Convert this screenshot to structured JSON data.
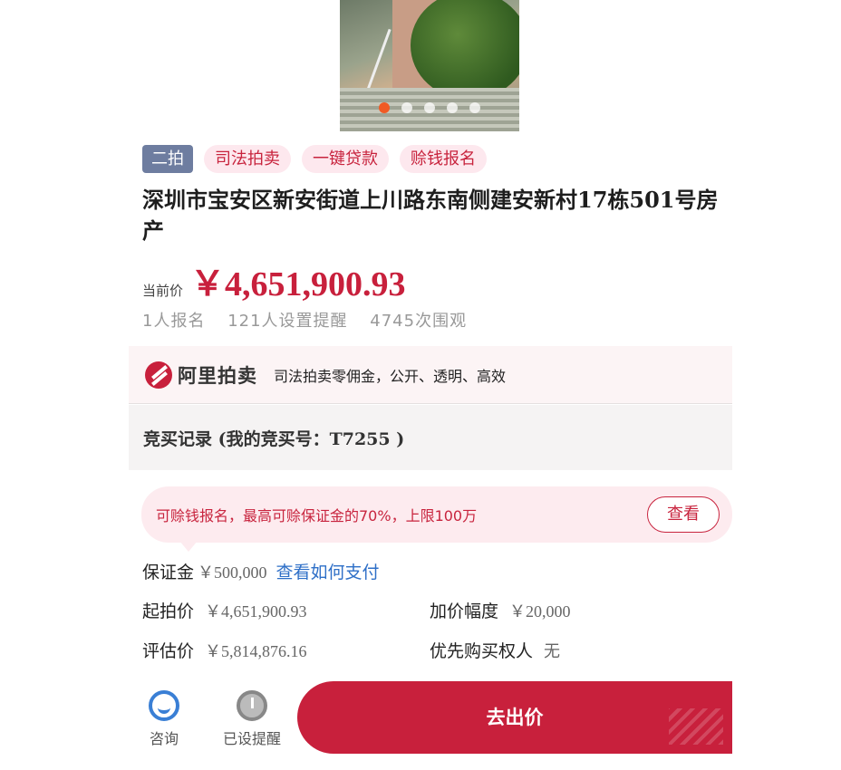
{
  "gallery": {
    "slide_count": 5,
    "active_index": 0
  },
  "tags": [
    "二拍",
    "司法拍卖",
    "一键贷款",
    "赊钱报名"
  ],
  "title": "深圳市宝安区新安街道上川路东南侧建安新村17栋501号房产",
  "price": {
    "label": "当前价",
    "value": "￥4,651,900.93"
  },
  "stats": {
    "signups": "1人报名",
    "reminders": "121人设置提醒",
    "views": "4745次围观"
  },
  "brand": {
    "name": "阿里拍卖",
    "slogan": "司法拍卖零佣金，公开、透明、高效"
  },
  "records": {
    "text": "竞买记录 (我的竞买号：T7255 )"
  },
  "notice": {
    "text": "可赊钱报名，最高可赊保证金的70%，上限100万",
    "button": "查看"
  },
  "deposit": {
    "label": "保证金",
    "value": "￥500,000",
    "link": "查看如何支付"
  },
  "info": {
    "start_price_label": "起拍价",
    "start_price": "￥4,651,900.93",
    "increment_label": "加价幅度",
    "increment": "￥20,000",
    "appraisal_label": "评估价",
    "appraisal": "￥5,814,876.16",
    "priority_label": "优先购买权人",
    "priority": "无"
  },
  "bottom": {
    "consult": "咨询",
    "reminder": "已设提醒",
    "bid": "去出价"
  },
  "colors": {
    "accent": "#c8203c",
    "link": "#2e6fc7",
    "active_dot": "#f05a24"
  }
}
